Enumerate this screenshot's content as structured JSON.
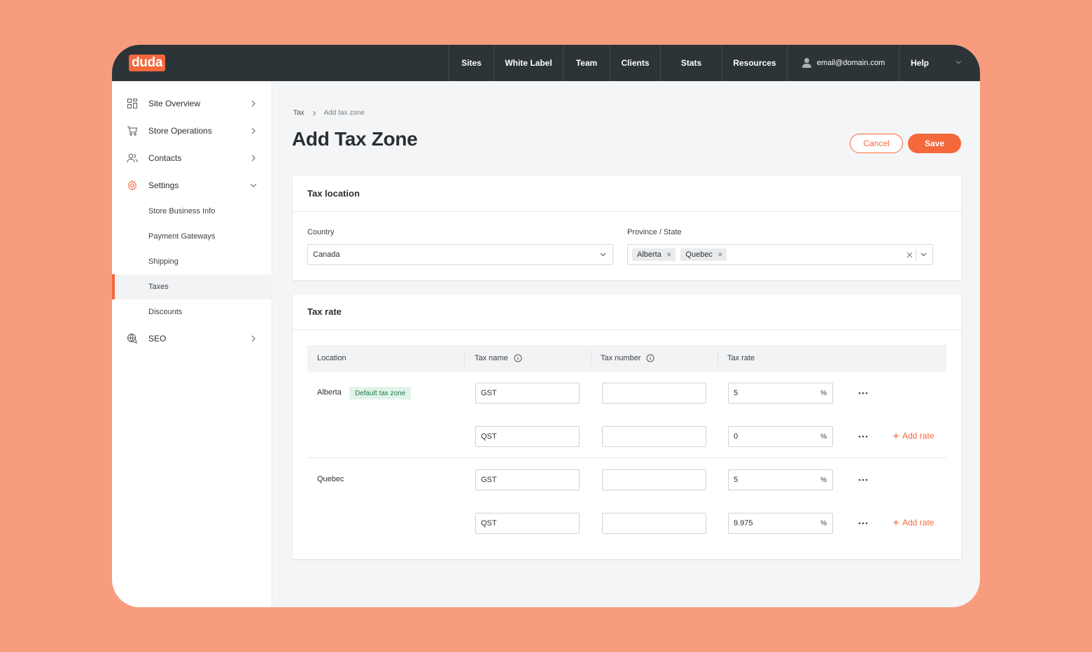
{
  "app": {
    "logo_text": "duda",
    "brand_color": "#f4683c"
  },
  "topnav": {
    "items": [
      {
        "label": "Sites"
      },
      {
        "label": "White Label"
      },
      {
        "label": "Team"
      },
      {
        "label": "Clients"
      },
      {
        "label": "Stats"
      },
      {
        "label": "Resources"
      }
    ],
    "user_email": "email@domain.com",
    "help_label": "Help"
  },
  "sidebar": {
    "items": [
      {
        "label": "Site Overview",
        "icon": "grid-icon"
      },
      {
        "label": "Store Operations",
        "icon": "cart-icon"
      },
      {
        "label": "Contacts",
        "icon": "contacts-icon"
      },
      {
        "label": "Settings",
        "icon": "gear-icon",
        "expanded": true
      },
      {
        "label": "SEO",
        "icon": "globe-search-icon"
      }
    ],
    "settings_sub": [
      {
        "label": "Store Business Info"
      },
      {
        "label": "Payment Gateways"
      },
      {
        "label": "Shipping"
      },
      {
        "label": "Taxes",
        "active": true
      },
      {
        "label": "Discounts"
      }
    ]
  },
  "breadcrumb": {
    "parent": "Tax",
    "current": "Add tax zone"
  },
  "page": {
    "title": "Add Tax Zone",
    "cancel_label": "Cancel",
    "save_label": "Save"
  },
  "tax_location": {
    "title": "Tax location",
    "country_label": "Country",
    "country_value": "Canada",
    "province_label": "Province / State",
    "province_values": [
      "Alberta",
      "Quebec"
    ]
  },
  "tax_rate": {
    "title": "Tax rate",
    "columns": {
      "location": "Location",
      "tax_name": "Tax name",
      "tax_number": "Tax number",
      "tax_rate": "Tax rate"
    },
    "default_badge": "Default tax zone",
    "percent_symbol": "%",
    "add_rate_label": "Add rate",
    "groups": [
      {
        "location": "Alberta",
        "rates": [
          {
            "name": "GST",
            "number": "",
            "rate": "5"
          },
          {
            "name": "QST",
            "number": "",
            "rate": "0"
          }
        ]
      },
      {
        "location": "Quebec",
        "rates": [
          {
            "name": "GST",
            "number": "",
            "rate": "5"
          },
          {
            "name": "QST",
            "number": "",
            "rate": "9.975"
          }
        ]
      }
    ]
  }
}
